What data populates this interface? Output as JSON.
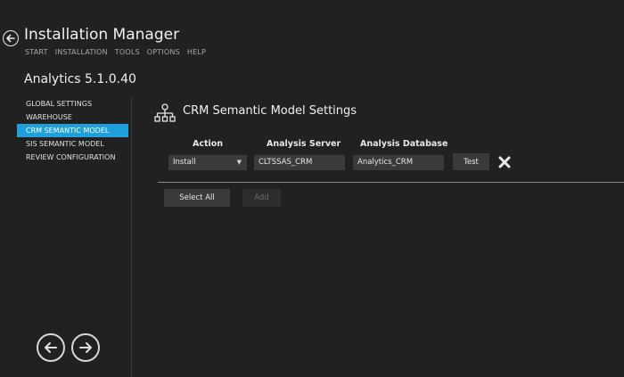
{
  "header": {
    "title": "Installation Manager",
    "menu": [
      "START",
      "INSTALLATION",
      "TOOLS",
      "OPTIONS",
      "HELP"
    ],
    "version": "Analytics 5.1.0.40",
    "back_icon": "arrow-left-circle-icon"
  },
  "sidebar": {
    "items": [
      {
        "label": "GLOBAL SETTINGS",
        "active": false
      },
      {
        "label": "WAREHOUSE",
        "active": false
      },
      {
        "label": "CRM SEMANTIC MODEL",
        "active": true
      },
      {
        "label": "SIS SEMANTIC MODEL",
        "active": false
      },
      {
        "label": "REVIEW CONFIGURATION",
        "active": false
      }
    ],
    "active_color": "#1fa0dc"
  },
  "section": {
    "title": "CRM Semantic Model Settings",
    "icon": "hierarchy-icon"
  },
  "table": {
    "headers": {
      "action": "Action",
      "server": "Analysis Server",
      "database": "Analysis Database"
    },
    "row": {
      "action": "Install",
      "server": "CLTSSAS_CRM",
      "database": "Analytics_CRM",
      "test_label": "Test"
    }
  },
  "buttons": {
    "select_all": "Select All",
    "add": "Add"
  },
  "colors": {
    "background": "#212121",
    "field": "#3a3a3a",
    "accent": "#1fa0dc"
  }
}
